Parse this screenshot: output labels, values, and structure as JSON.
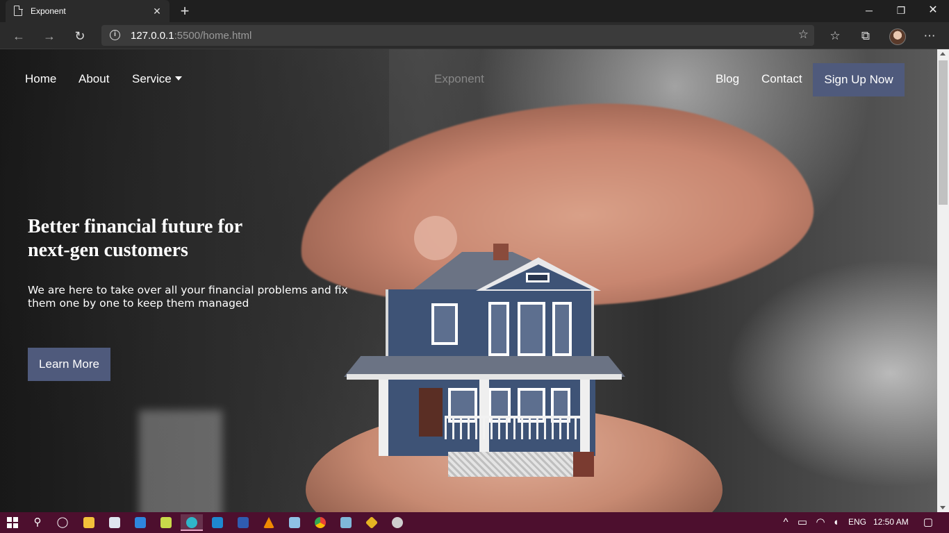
{
  "browser": {
    "tab_title": "Exponent",
    "url_host": "127.0.0.1",
    "url_rest": ":5500/home.html",
    "new_tab": "+",
    "tab_close": "✕"
  },
  "site": {
    "nav": {
      "home": "Home",
      "about": "About",
      "service": "Service",
      "brand": "Exponent",
      "blog": "Blog",
      "contact": "Contact",
      "signup": "Sign Up Now"
    },
    "hero": {
      "title": "Better financial future for next-gen customers",
      "text": "We are here to take over all your financial problems and fix them one by one to keep them managed",
      "cta": "Learn More"
    }
  },
  "taskbar": {
    "language": "ENG",
    "time": "12:50 AM"
  },
  "colors": {
    "accent_button": "#4f5a7c",
    "taskbar": "#4d0f2e"
  }
}
